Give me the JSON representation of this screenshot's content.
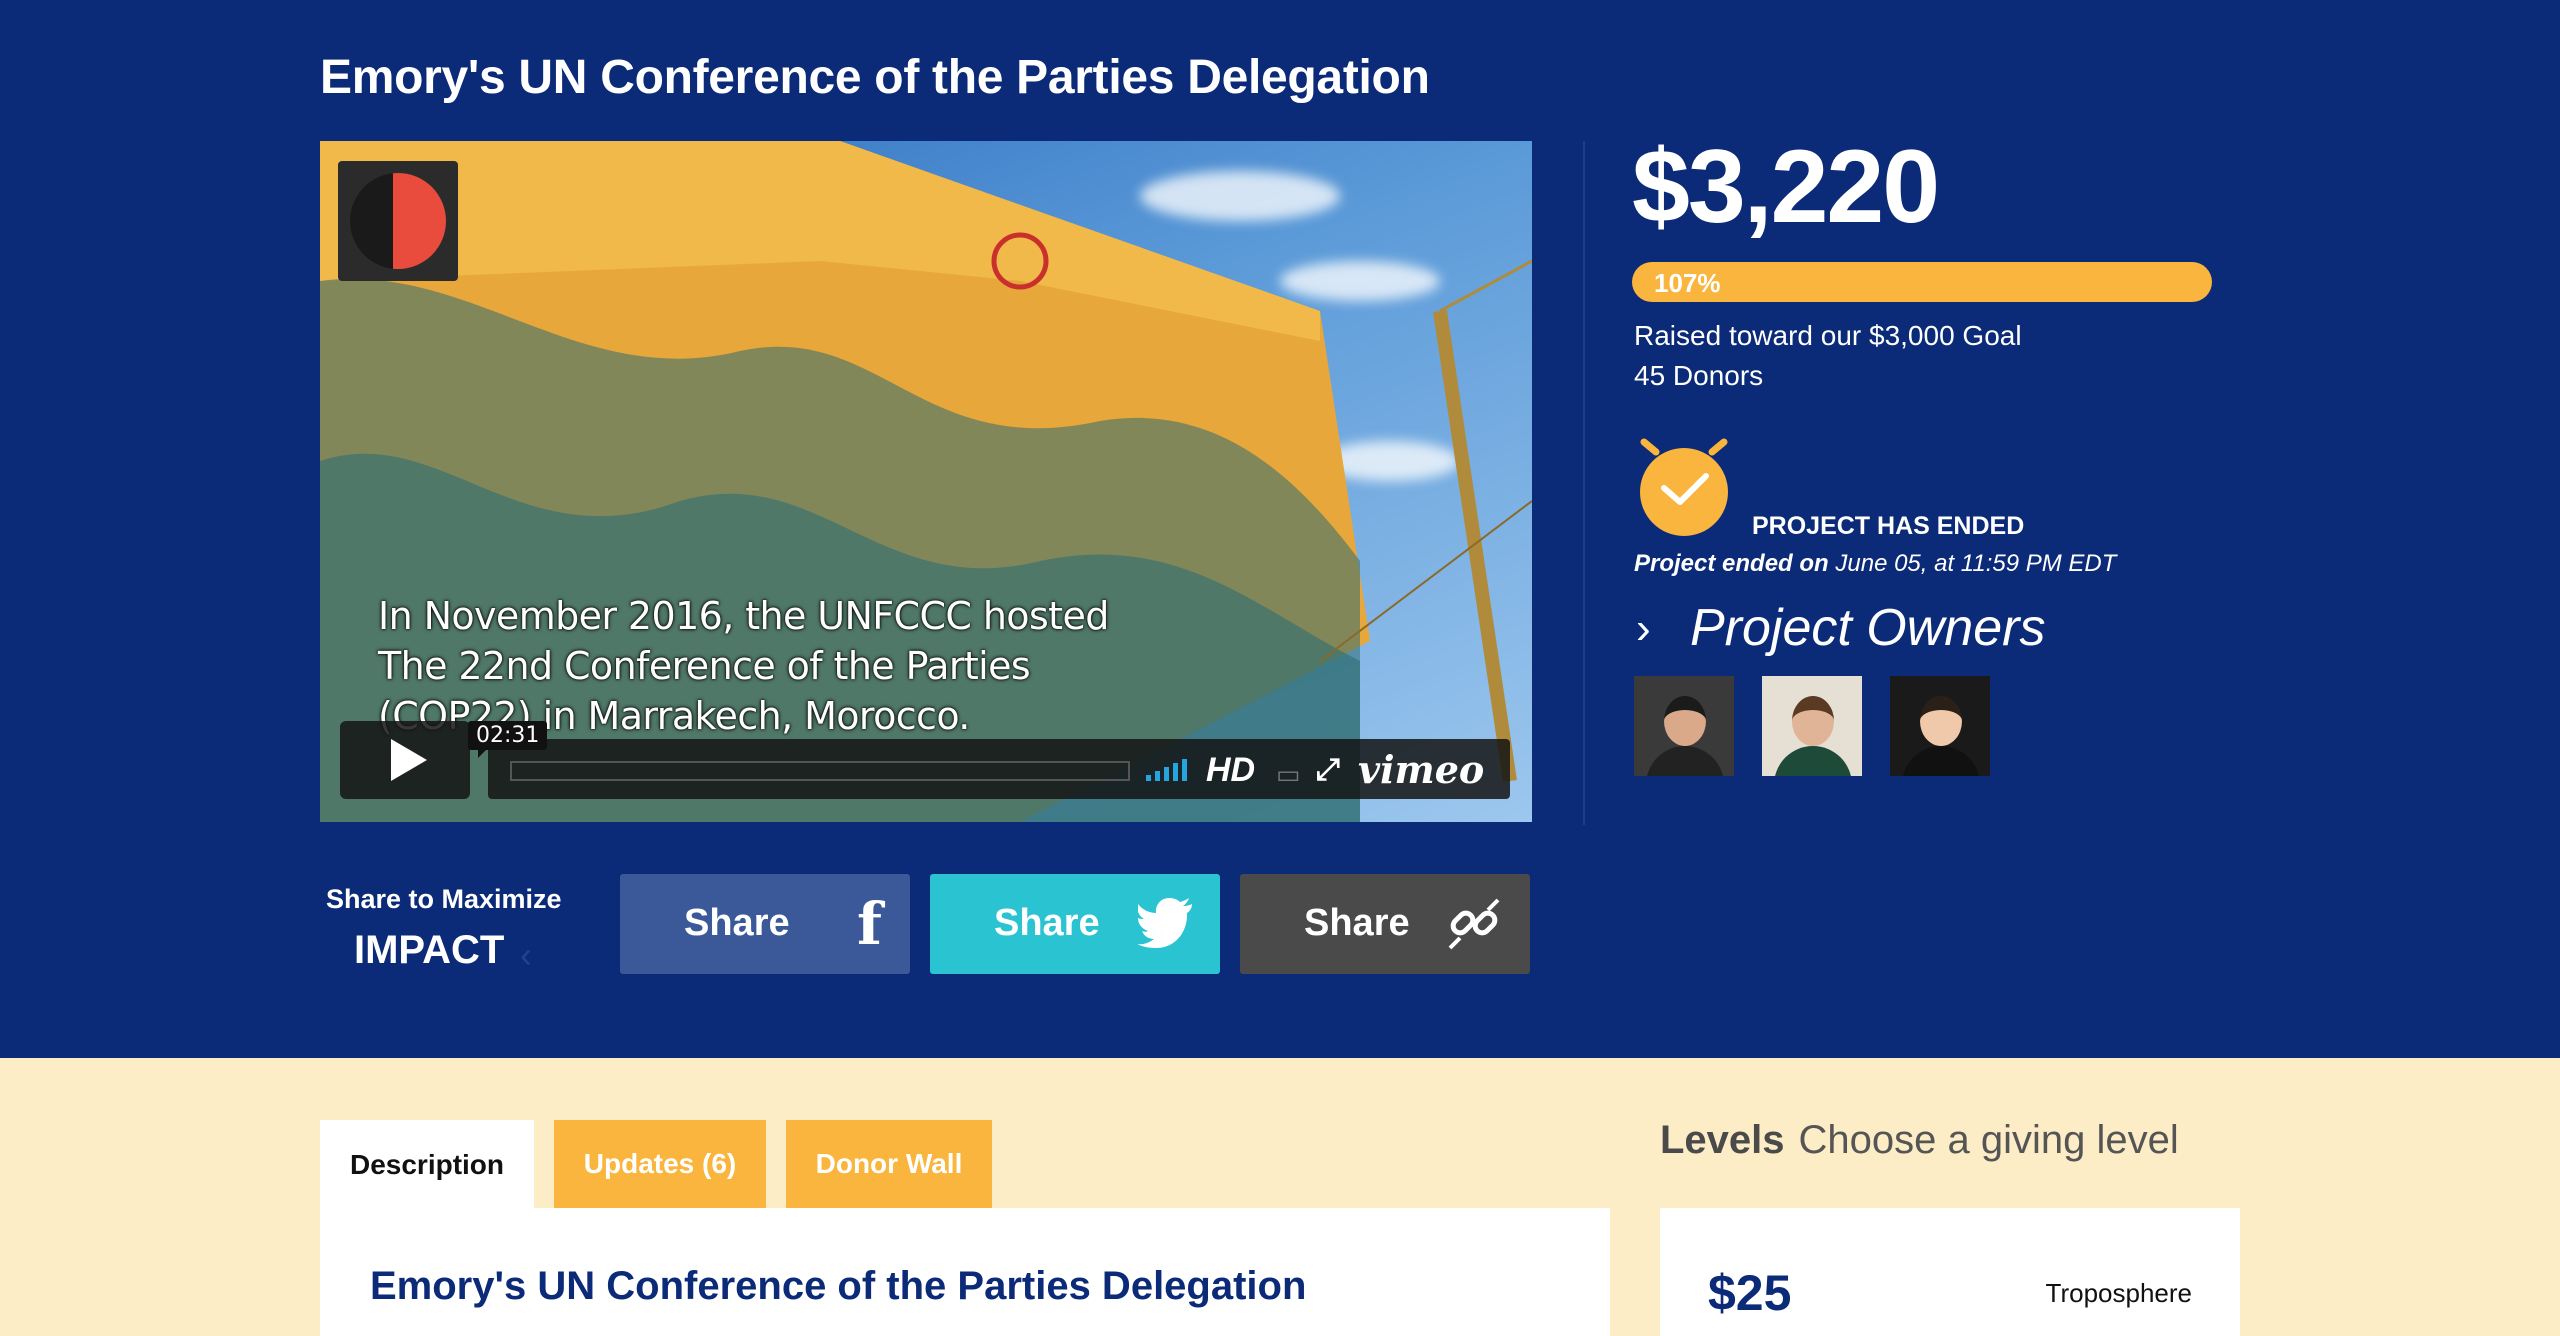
{
  "page_title": "Emory's UN Conference of the Parties Delegation",
  "video": {
    "caption": "In November 2016, the UNFCCC hosted The 22nd Conference of the Parties (COP22) in Marrakech, Morocco.",
    "time": "02:31",
    "hd_label": "HD",
    "brand": "vimeo",
    "play_icon": "play-icon",
    "fullscreen_icon": "fullscreen-icon",
    "airplay_icon": "airplay-icon",
    "volume_icon": "volume-icon"
  },
  "stats": {
    "amount": "$3,220",
    "percent_label": "107%",
    "percent_value": 107,
    "raised_text": "Raised toward our $3,000 Goal",
    "donors_text": "45 Donors",
    "status": "PROJECT HAS ENDED",
    "ended_prefix": "Project ended on",
    "ended_date": " June 05, at 11:59 PM EDT",
    "owners_heading": "Project Owners"
  },
  "share": {
    "label": "Share to Maximize",
    "impact": "IMPACT",
    "buttons": [
      {
        "label": "Share",
        "icon": "facebook-icon"
      },
      {
        "label": "Share",
        "icon": "twitter-icon"
      },
      {
        "label": "Share",
        "icon": "link-icon"
      }
    ]
  },
  "tabs": [
    {
      "label": "Description"
    },
    {
      "label": "Updates (6)"
    },
    {
      "label": "Donor Wall"
    }
  ],
  "description": {
    "title": "Emory's UN Conference of the Parties Delegation"
  },
  "levels": {
    "heading": "Levels",
    "subheading": "Choose a giving level",
    "items": [
      {
        "amount": "$25",
        "name": "Troposphere"
      }
    ]
  },
  "colors": {
    "primary": "#0b2a77",
    "accent": "#f9b53d",
    "facebook": "#3b5998",
    "twitter": "#29c3d2",
    "link": "#4a4a4a",
    "lower_bg": "#fdedc7"
  }
}
